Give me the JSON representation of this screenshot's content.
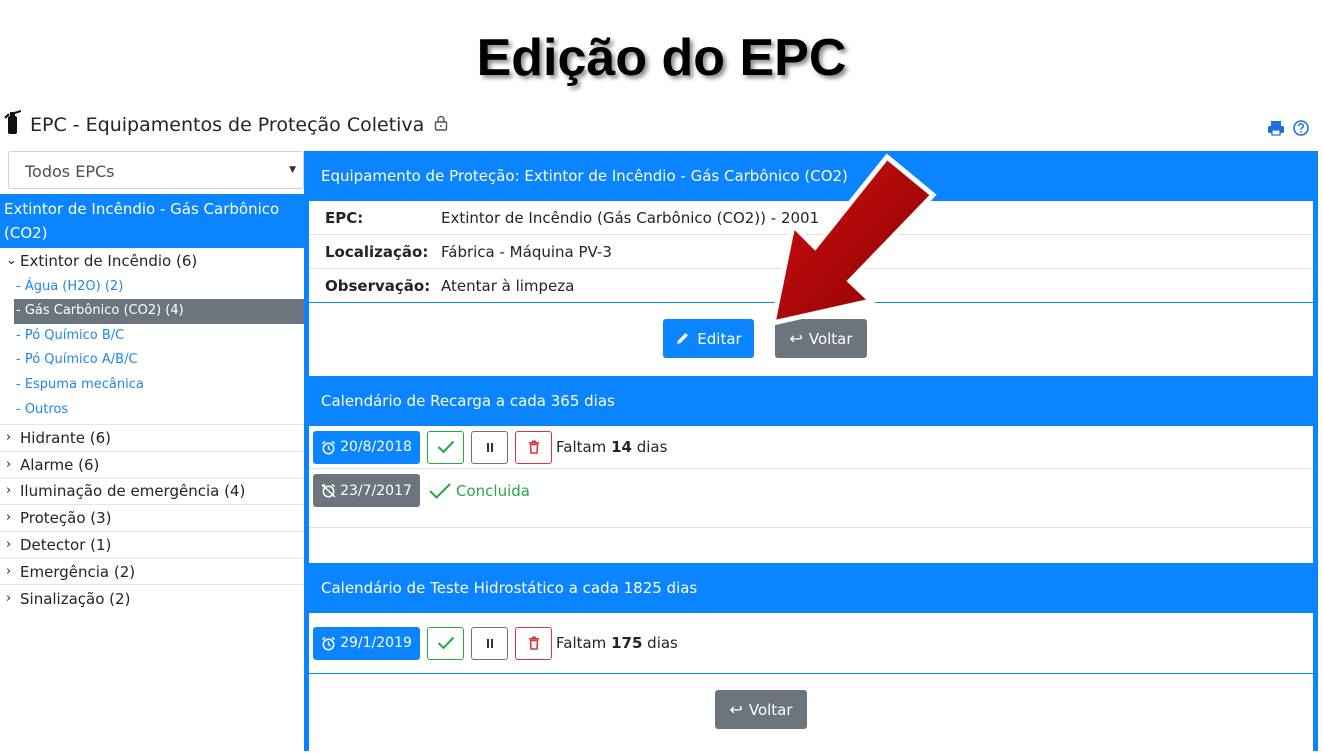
{
  "slide": {
    "title": "Edição do EPC"
  },
  "header": {
    "title": "EPC - Equipamentos de Proteção Coletiva"
  },
  "sidebar": {
    "filter": "Todos EPCs",
    "selected": "Extintor de Incêndio - Gás Carbônico (CO2)",
    "open_group": "Extintor de Incêndio (6)",
    "sub_items": [
      "- Água (H2O) (2)",
      "- Gás Carbônico (CO2) (4)",
      "- Pó Químico B/C",
      "- Pó Químico A/B/C",
      "- Espuma mecânica",
      "- Outros"
    ],
    "groups": [
      "Hidrante (6)",
      "Alarme (6)",
      "Iluminação de emergência (4)",
      "Proteção (3)",
      "Detector (1)",
      "Emergência (2)",
      "Sinalização (2)"
    ]
  },
  "equipment": {
    "heading": "Equipamento de Proteção: Extintor de Incêndio - Gás Carbônico (CO2)",
    "epc_label": "EPC:",
    "epc_value": "Extintor de Incêndio (Gás Carbônico (CO2)) - 2001",
    "loc_label": "Localização:",
    "loc_value": "Fábrica - Máquina PV-3",
    "obs_label": "Observação:",
    "obs_value": "Atentar à limpeza",
    "edit_label": "Editar",
    "back_label": "Voltar"
  },
  "recharge": {
    "heading": "Calendário de Recarga a cada 365 dias",
    "row1_date": "20/8/2018",
    "row1_prefix": "Faltam",
    "row1_days": "14",
    "row1_suffix": "dias",
    "row2_date": "23/7/2017",
    "row2_status": "Concluida"
  },
  "hydro": {
    "heading": "Calendário de Teste Hidrostático a cada 1825 dias",
    "row1_date": "29/1/2019",
    "row1_prefix": "Faltam",
    "row1_days": "175",
    "row1_suffix": "dias",
    "back_label": "Voltar"
  },
  "colors": {
    "primary": "#0a84ff",
    "secondary": "#6c757d",
    "success": "#28a745",
    "danger": "#dc3545",
    "arrow": "#c00000"
  }
}
